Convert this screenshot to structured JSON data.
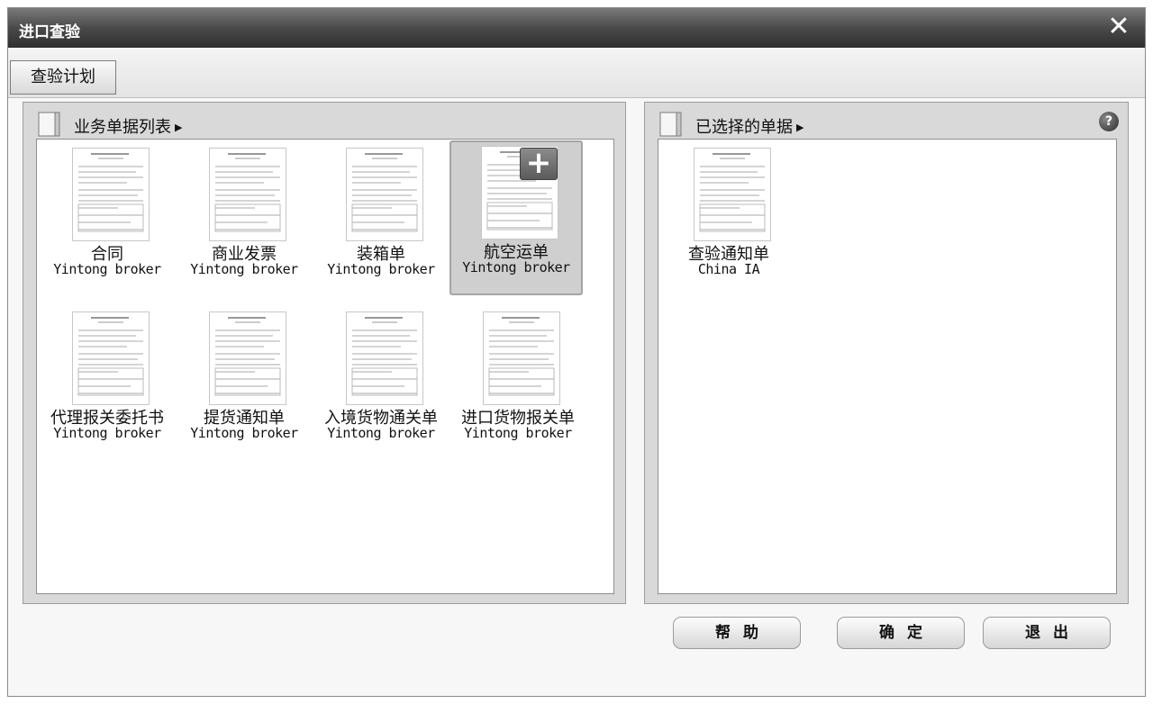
{
  "window": {
    "title": "进口查验"
  },
  "tabs": [
    {
      "label": "查验计划"
    }
  ],
  "left_panel": {
    "title": "业务单据列表",
    "items": [
      {
        "name": "合同",
        "owner": "Yintong broker"
      },
      {
        "name": "商业发票",
        "owner": "Yintong broker"
      },
      {
        "name": "装箱单",
        "owner": "Yintong broker"
      },
      {
        "name": "航空运单",
        "owner": "Yintong broker",
        "selected": true
      },
      {
        "name": "代理报关委托书",
        "owner": "Yintong broker"
      },
      {
        "name": "提货通知单",
        "owner": "Yintong broker"
      },
      {
        "name": "入境货物通关单",
        "owner": "Yintong broker"
      },
      {
        "name": "进口货物报关单",
        "owner": "Yintong broker"
      }
    ]
  },
  "right_panel": {
    "title": "已选择的单据",
    "items": [
      {
        "name": "查验通知单",
        "owner": "China IA"
      }
    ]
  },
  "buttons": {
    "help": "帮助",
    "ok": "确定",
    "exit": "退出"
  },
  "icons": {
    "close": "close-icon",
    "help": "help-icon",
    "add": "plus-icon",
    "panel": "book-icon",
    "triangle": "triangle-right-icon"
  },
  "colors": {
    "titlebar": "#4a4a4a",
    "dialog": "#f7f7f7",
    "panel": "#d9d9d9",
    "selected": "#cfcfcf"
  }
}
